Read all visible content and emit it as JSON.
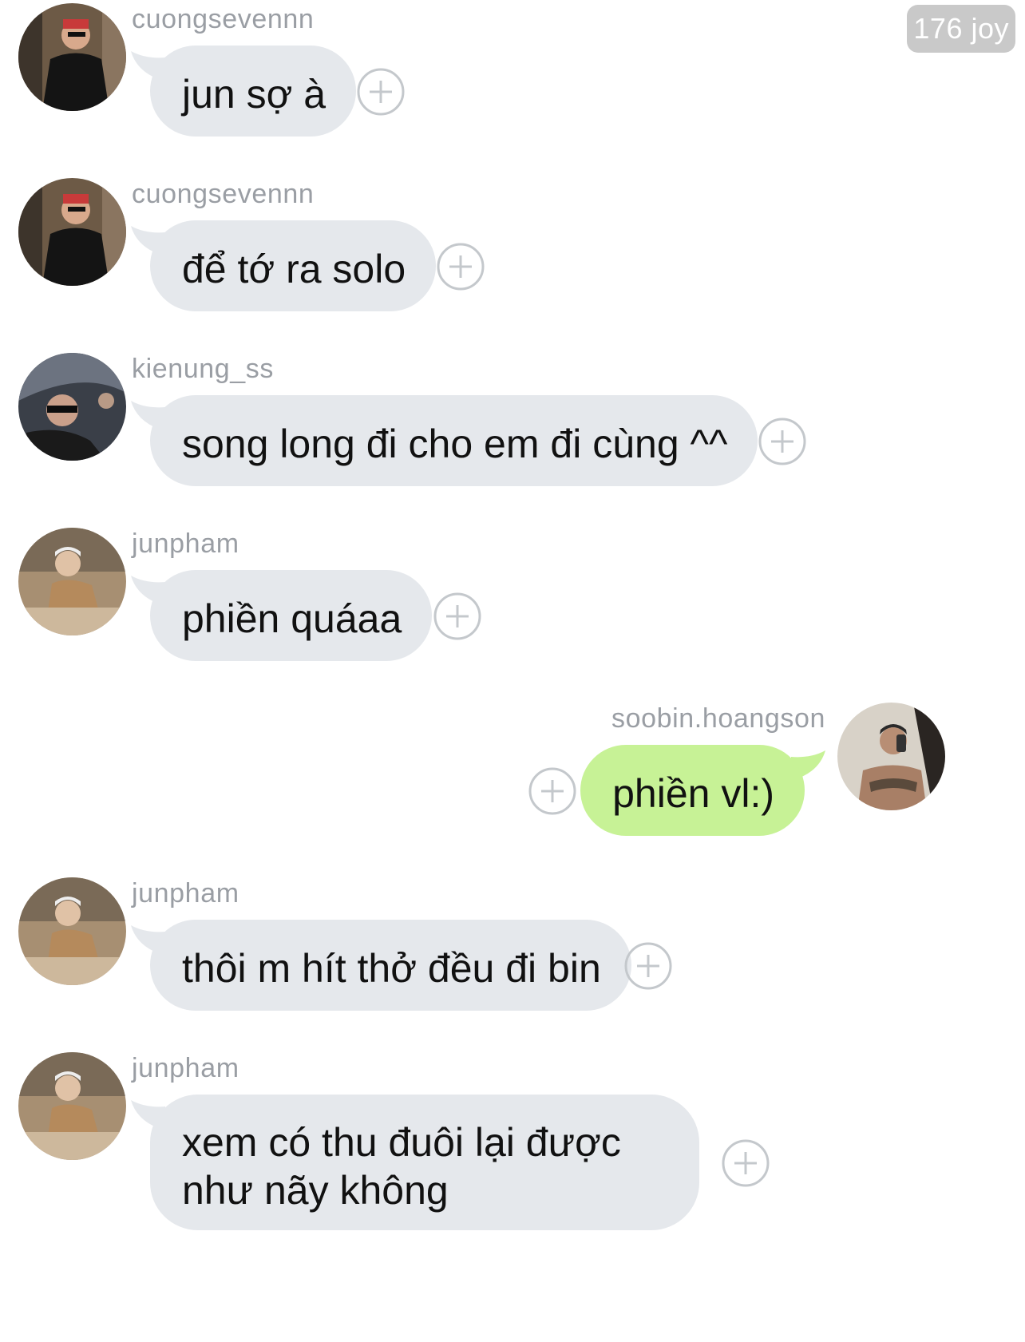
{
  "watermark": "176 joy",
  "colors": {
    "incoming_bubble": "#e5e8ec",
    "outgoing_bubble": "#c7f296",
    "username_text": "#9a9ea4",
    "plus_icon": "#c4c8cc"
  },
  "messages": [
    {
      "username": "cuongsevennn",
      "text": "jun sợ à",
      "side": "incoming",
      "avatar_icon": "user-avatar-icon"
    },
    {
      "username": "cuongsevennn",
      "text": "để tớ ra solo",
      "side": "incoming",
      "avatar_icon": "user-avatar-icon"
    },
    {
      "username": "kienung_ss",
      "text": "song long đi cho em đi cùng ^^",
      "side": "incoming",
      "avatar_icon": "user-avatar-icon"
    },
    {
      "username": "junpham",
      "text": "phiền quáaa",
      "side": "incoming",
      "avatar_icon": "user-avatar-icon"
    },
    {
      "username": "soobin.hoangson",
      "text": "phiền vl:)",
      "side": "outgoing",
      "avatar_icon": "user-avatar-icon"
    },
    {
      "username": "junpham",
      "text": "thôi m hít thở đều đi bin",
      "side": "incoming",
      "avatar_icon": "user-avatar-icon"
    },
    {
      "username": "junpham",
      "text": "xem có thu đuôi lại được như nãy không",
      "side": "incoming",
      "avatar_icon": "user-avatar-icon"
    }
  ]
}
